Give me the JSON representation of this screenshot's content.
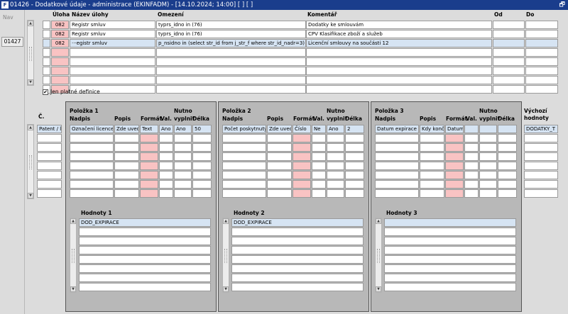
{
  "window": {
    "title": "01426 - Dodatkové údaje - administrace (EKINFADM) - [14.10.2024; 14:00]  [ ]  [ ]",
    "app_icon": "F",
    "restore_icon": "restore-icon",
    "restore_glyph": "🗗"
  },
  "left_panel": {
    "nav_label": "Nav",
    "form_id": "01427"
  },
  "top_grid": {
    "headers": {
      "uloha": "Úloha",
      "nazev": "Název úlohy",
      "omezeni": "Omezení",
      "komentar": "Komentář",
      "od": "Od",
      "do": "Do"
    },
    "rows": [
      {
        "uloha": "082",
        "nazev": "Registr smluv",
        "omezeni": "typrs_idno in (76)",
        "komentar": "Dodatky ke smlouvám",
        "od": "",
        "do": ""
      },
      {
        "uloha": "082",
        "nazev": "Registr smluv",
        "omezeni": "typrs_idno in (76)",
        "komentar": "CPV Klasifikace zboží a služeb",
        "od": "",
        "do": ""
      },
      {
        "uloha": "082",
        "nazev": "···egistr smluv",
        "omezeni": "p_nsidno in (select str_id from j_str_f where str_id_nadr=3) and",
        "komentar": "Licenční smlouvy na součásti 12",
        "od": "",
        "do": ""
      }
    ],
    "empty_rows": 5
  },
  "checkbox": {
    "label": "Jen platné definice",
    "checked": true,
    "check_glyph": "✔"
  },
  "items": {
    "c_label": "Č.",
    "c_first": "Patent / li",
    "vychozi_label_1": "Výchozí",
    "vychozi_label_2": "hodnoty",
    "vychozi_first": "DODATKY_T",
    "groups": [
      {
        "title": "Položka 1",
        "nadpis": "Nadpis",
        "popis": "Popis",
        "format": "Formát",
        "val": "Val.",
        "nutno_1": "Nutno",
        "nutno_2": "vyplnit",
        "delka": "Délka",
        "row": {
          "nadpis": "Označení licence",
          "popis": "Zde uved",
          "format": "Text",
          "val": "Ano",
          "nutno": "Ano",
          "delka": "50"
        },
        "values_title": "Hodnoty 1",
        "values": [
          "DOD_EXPIRACE"
        ]
      },
      {
        "title": "Položka 2",
        "nadpis": "Nadpis",
        "popis": "Popis",
        "format": "Formát",
        "val": "Val.",
        "nutno_1": "Nutno",
        "nutno_2": "vyplnit",
        "delka": "Délka",
        "row": {
          "nadpis": "Počet poskytnutý",
          "popis": "Zde uved",
          "format": "Číslo",
          "val": "Ne",
          "nutno": "Ano",
          "delka": "2"
        },
        "values_title": "Hodnoty 2",
        "values": [
          "DOD_EXPIRACE"
        ]
      },
      {
        "title": "Položka 3",
        "nadpis": "Nadpis",
        "popis": "Popis",
        "format": "Formát",
        "val": "Val.",
        "nutno_1": "Nutno",
        "nutno_2": "vyplnit",
        "delka": "Délka",
        "row": {
          "nadpis": "Datum expirace",
          "popis": "Kdy konč",
          "format": "Datum",
          "val": "",
          "nutno": "",
          "delka": ""
        },
        "values_title": "Hodnoty 3",
        "values": [
          ""
        ]
      }
    ]
  },
  "icons": {
    "scroll_up": "scroll-up-arrow-icon",
    "scroll_down": "scroll-down-arrow-icon"
  },
  "glyphs": {
    "up": "▲",
    "down": "▼"
  }
}
